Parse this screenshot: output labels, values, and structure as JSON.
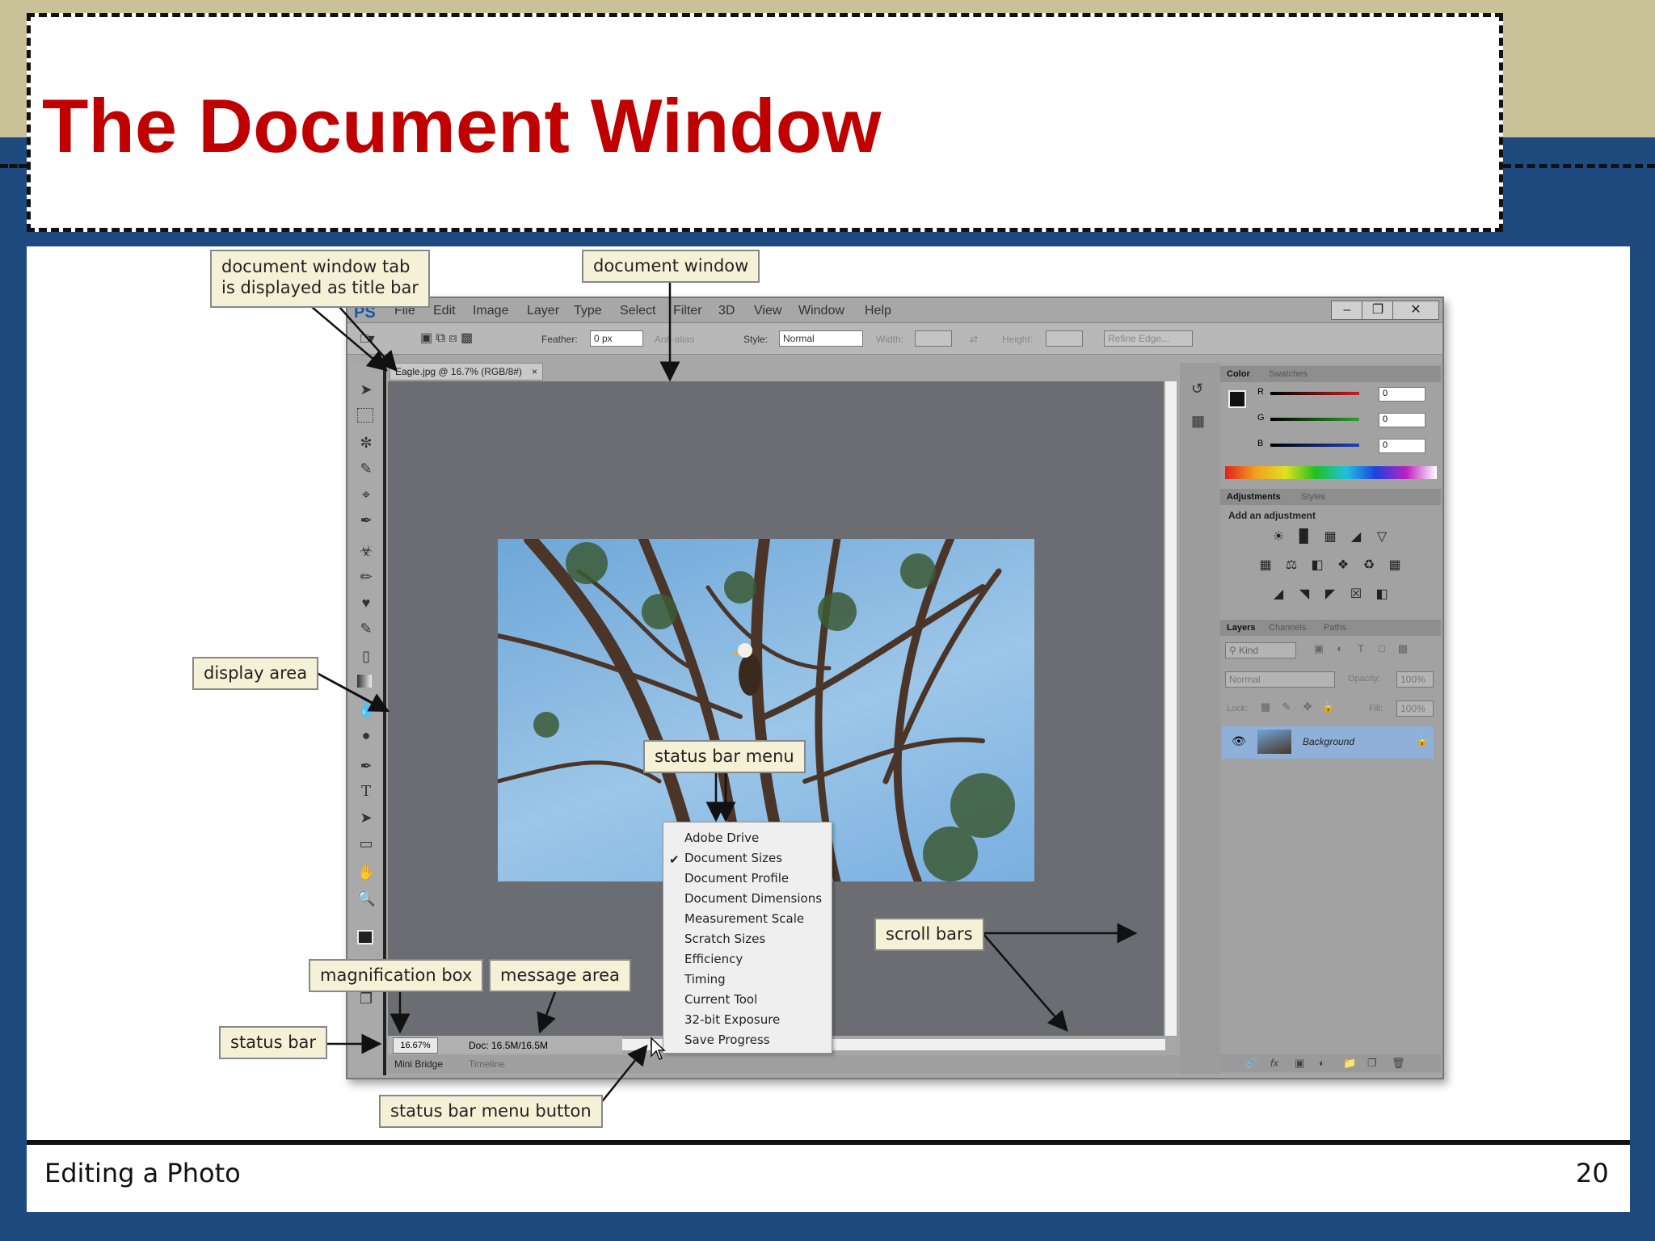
{
  "slide": {
    "title": "The Document Window",
    "footer_left": "Editing a Photo",
    "page_number": "20"
  },
  "callouts": {
    "tab": "document window tab\nis displayed as title bar",
    "document_window": "document window",
    "display_area": "display area",
    "status_bar_menu": "status bar menu",
    "scroll_bars": "scroll bars",
    "magnification_box": "magnification box",
    "message_area": "message area",
    "status_bar": "status bar",
    "status_bar_menu_button": "status bar menu button"
  },
  "photoshop": {
    "logo": "PS",
    "menu": [
      "File",
      "Edit",
      "Image",
      "Layer",
      "Type",
      "Select",
      "Filter",
      "3D",
      "View",
      "Window",
      "Help"
    ],
    "options": {
      "feather_label": "Feather:",
      "feather_value": "0 px",
      "anti_alias": "Anti-alias",
      "style_label": "Style:",
      "style_value": "Normal",
      "width_label": "Width:",
      "height_label": "Height:",
      "refine_edge": "Refine Edge..."
    },
    "doc_tab": "Eagle.jpg @ 16.7% (RGB/8#)",
    "status": {
      "magnification": "16.67%",
      "message": "Doc: 16.5M/16.5M"
    },
    "bottom_tabs": [
      "Mini Bridge",
      "Timeline"
    ],
    "color_panel": {
      "tabs": [
        "Color",
        "Swatches"
      ],
      "channels": [
        {
          "label": "R",
          "value": "0",
          "color": "#c62020"
        },
        {
          "label": "G",
          "value": "0",
          "color": "#2ea02e"
        },
        {
          "label": "B",
          "value": "0",
          "color": "#2040c0"
        }
      ]
    },
    "adjustments_panel": {
      "tabs": [
        "Adjustments",
        "Styles"
      ],
      "heading": "Add an adjustment"
    },
    "layers_panel": {
      "tabs": [
        "Layers",
        "Channels",
        "Paths"
      ],
      "kind": "Kind",
      "blend_mode": "Normal",
      "opacity_label": "Opacity:",
      "opacity_value": "100%",
      "lock_label": "Lock:",
      "fill_label": "Fill:",
      "fill_value": "100%",
      "layer_name": "Background"
    }
  },
  "status_menu": {
    "checked": "Document Sizes",
    "items": [
      "Adobe Drive",
      "Document Sizes",
      "Document Profile",
      "Document Dimensions",
      "Measurement Scale",
      "Scratch Sizes",
      "Efficiency",
      "Timing",
      "Current Tool",
      "32-bit Exposure",
      "Save Progress"
    ]
  },
  "colors": {
    "title_red": "#c00000",
    "slide_blue": "#1f4a80",
    "top_band": "#c9c198",
    "callout_fill": "#f5f1d6"
  }
}
